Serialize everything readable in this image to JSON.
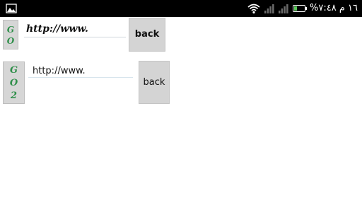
{
  "status_bar": {
    "left_icon": "image-icon",
    "right_text": "%١٦ م ٧:٤٨",
    "icons": [
      "wifi-icon",
      "signal-icon",
      "signal-icon",
      "battery-icon"
    ],
    "battery_fill_color": "#5ac85a"
  },
  "row1": {
    "go_label_lines": [
      "G",
      "O"
    ],
    "url_value": "http://www.",
    "back_label": "back"
  },
  "row2": {
    "go_label_lines": [
      "G",
      "O",
      "2"
    ],
    "url_value": "http://www.",
    "back_label": "back"
  },
  "colors": {
    "go_text": "#2f8f4a",
    "button_bg": "#d6d6d6",
    "statusbar_bg": "#000000"
  }
}
